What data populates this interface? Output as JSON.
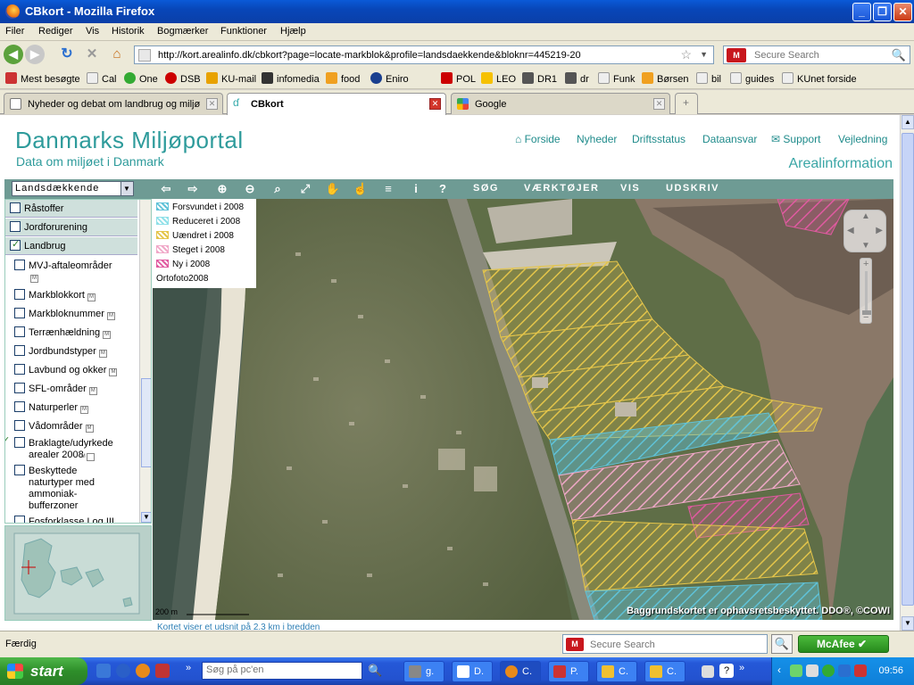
{
  "window": {
    "title": "CBkort - Mozilla Firefox"
  },
  "menu": [
    "Filer",
    "Rediger",
    "Vis",
    "Historik",
    "Bogmærker",
    "Funktioner",
    "Hjælp"
  ],
  "nav": {
    "url": "http://kort.arealinfo.dk/cbkort?page=locate-markblok&profile=landsdaekkende&bloknr=445219-20",
    "search_placeholder": "Secure Search"
  },
  "bookmarks": [
    "Mest besøgte",
    "Cal",
    "One",
    "DSB",
    "KU-mail",
    "infomedia",
    "food",
    "Eniro",
    "POL",
    "LEO",
    "DR1",
    "dr",
    "Funk",
    "Børsen",
    "bil",
    "guides",
    "KUnet forside"
  ],
  "tabs": [
    {
      "label": "Nyheder og debat om landbrug og miljø"
    },
    {
      "label": "CBkort"
    },
    {
      "label": "Google"
    }
  ],
  "site": {
    "title": "Danmarks Miljøportal",
    "subtitle": "Data om miljøet i Danmark",
    "nav": [
      "Forside",
      "Nyheder",
      "Driftsstatus",
      "Dataansvar",
      "Support",
      "Vejledning"
    ],
    "section": "Arealinformation"
  },
  "toolbar": {
    "layer_select": "Landsdækkende",
    "menus": [
      "SØG",
      "VÆRKTØJER",
      "VIS",
      "UDSKRIV"
    ]
  },
  "left_panel": {
    "groups": [
      "Råstoffer",
      "Jordforurening",
      "Landbrug"
    ],
    "items": [
      {
        "label": "MVJ-aftaleområder",
        "checked": false
      },
      {
        "label": "Markblokkort",
        "checked": false
      },
      {
        "label": "Markbloknummer",
        "checked": false
      },
      {
        "label": "Terrænhældning",
        "checked": false
      },
      {
        "label": "Jordbundstyper",
        "checked": false
      },
      {
        "label": "Lavbund og okker",
        "checked": false
      },
      {
        "label": "SFL-områder",
        "checked": false
      },
      {
        "label": "Naturperler",
        "checked": false
      },
      {
        "label": "Vådområder",
        "checked": false
      },
      {
        "label": "Braklagte/udyrkede arealer 2008",
        "checked": true
      },
      {
        "label": "Beskyttede naturtyper med ammoniak-bufferzoner",
        "checked": false
      },
      {
        "label": "Fosforklasse I og III",
        "checked": false
      }
    ]
  },
  "legend": [
    {
      "label": "Forsvundet i 2008",
      "color": "#5fc2d8"
    },
    {
      "label": "Reduceret i 2008",
      "color": "#8fe0e8"
    },
    {
      "label": "Uændret i 2008",
      "color": "#e4c54a"
    },
    {
      "label": "Steget i 2008",
      "color": "#f0a8c8"
    },
    {
      "label": "Ny i 2008",
      "color": "#e05aa0"
    },
    {
      "label": "Ortofoto2008",
      "color": ""
    }
  ],
  "map": {
    "copyright": "Baggrundskortet er ophavsretsbeskyttet. DDO®, ©COWI",
    "scale": "200 m",
    "note": "Kortet viser et udsnit på 2.3 km i bredden"
  },
  "status": {
    "text": "Færdig",
    "search_placeholder": "Secure Search",
    "mcafee": "McAfee"
  },
  "taskbar": {
    "start": "start",
    "search_placeholder": "Søg på pc'en",
    "tasks": [
      "g.",
      "D.",
      "C.",
      "P.",
      "C.",
      "C."
    ],
    "clock": "09:56"
  }
}
